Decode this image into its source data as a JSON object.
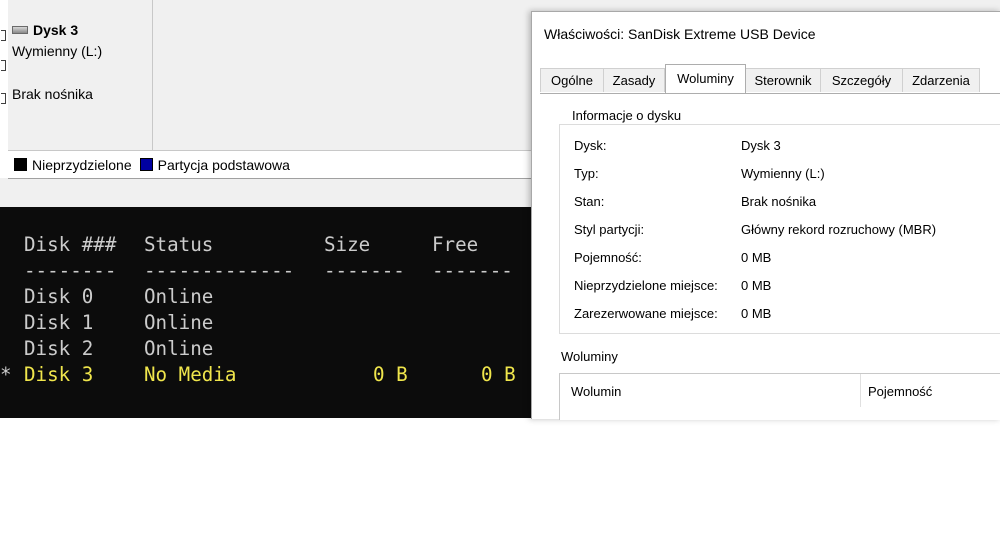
{
  "disk_management": {
    "disk": {
      "name": "Dysk 3",
      "type": "Wymienny (L:)",
      "media": "Brak nośnika"
    },
    "legend": [
      {
        "label": "Nieprzydzielone",
        "color": "#000000"
      },
      {
        "label": "Partycja podstawowa",
        "color": "#0000a0"
      }
    ]
  },
  "console": {
    "header": [
      "Disk ###",
      "Status",
      "Size",
      "Free"
    ],
    "separator": [
      "--------",
      "-------------",
      "-------",
      "-------"
    ],
    "rows": [
      {
        "marker": "",
        "disk": "Disk 0",
        "status": "Online",
        "size": "",
        "free": "",
        "highlight": false
      },
      {
        "marker": "",
        "disk": "Disk 1",
        "status": "Online",
        "size": "",
        "free": "",
        "highlight": false
      },
      {
        "marker": "",
        "disk": "Disk 2",
        "status": "Online",
        "size": "",
        "free": "",
        "highlight": false
      },
      {
        "marker": "*",
        "disk": "Disk 3",
        "status": "No Media",
        "size": "0 B",
        "free": "0 B",
        "highlight": true
      }
    ],
    "colors": {
      "background": "#0c0c0c",
      "text": "#cccccc",
      "highlight": "#f0e64c"
    }
  },
  "dialog": {
    "title": "Właściwości: SanDisk Extreme USB Device",
    "tabs": [
      "Ogólne",
      "Zasady",
      "Woluminy",
      "Sterownik",
      "Szczegóły",
      "Zdarzenia"
    ],
    "active_tab": "Woluminy",
    "disk_info": {
      "group_title": "Informacje o dysku",
      "props": [
        {
          "label": "Dysk:",
          "value": "Dysk 3"
        },
        {
          "label": "Typ:",
          "value": "Wymienny (L:)"
        },
        {
          "label": "Stan:",
          "value": "Brak nośnika"
        },
        {
          "label": "Styl partycji:",
          "value": "Główny rekord rozruchowy (MBR)"
        },
        {
          "label": "Pojemność:",
          "value": "0 MB"
        },
        {
          "label": "Nieprzydzielone miejsce:",
          "value": "0 MB"
        },
        {
          "label": "Zarezerwowane miejsce:",
          "value": "0 MB"
        }
      ]
    },
    "volumes": {
      "title": "Woluminy",
      "columns": [
        "Wolumin",
        "Pojemność"
      ]
    }
  }
}
